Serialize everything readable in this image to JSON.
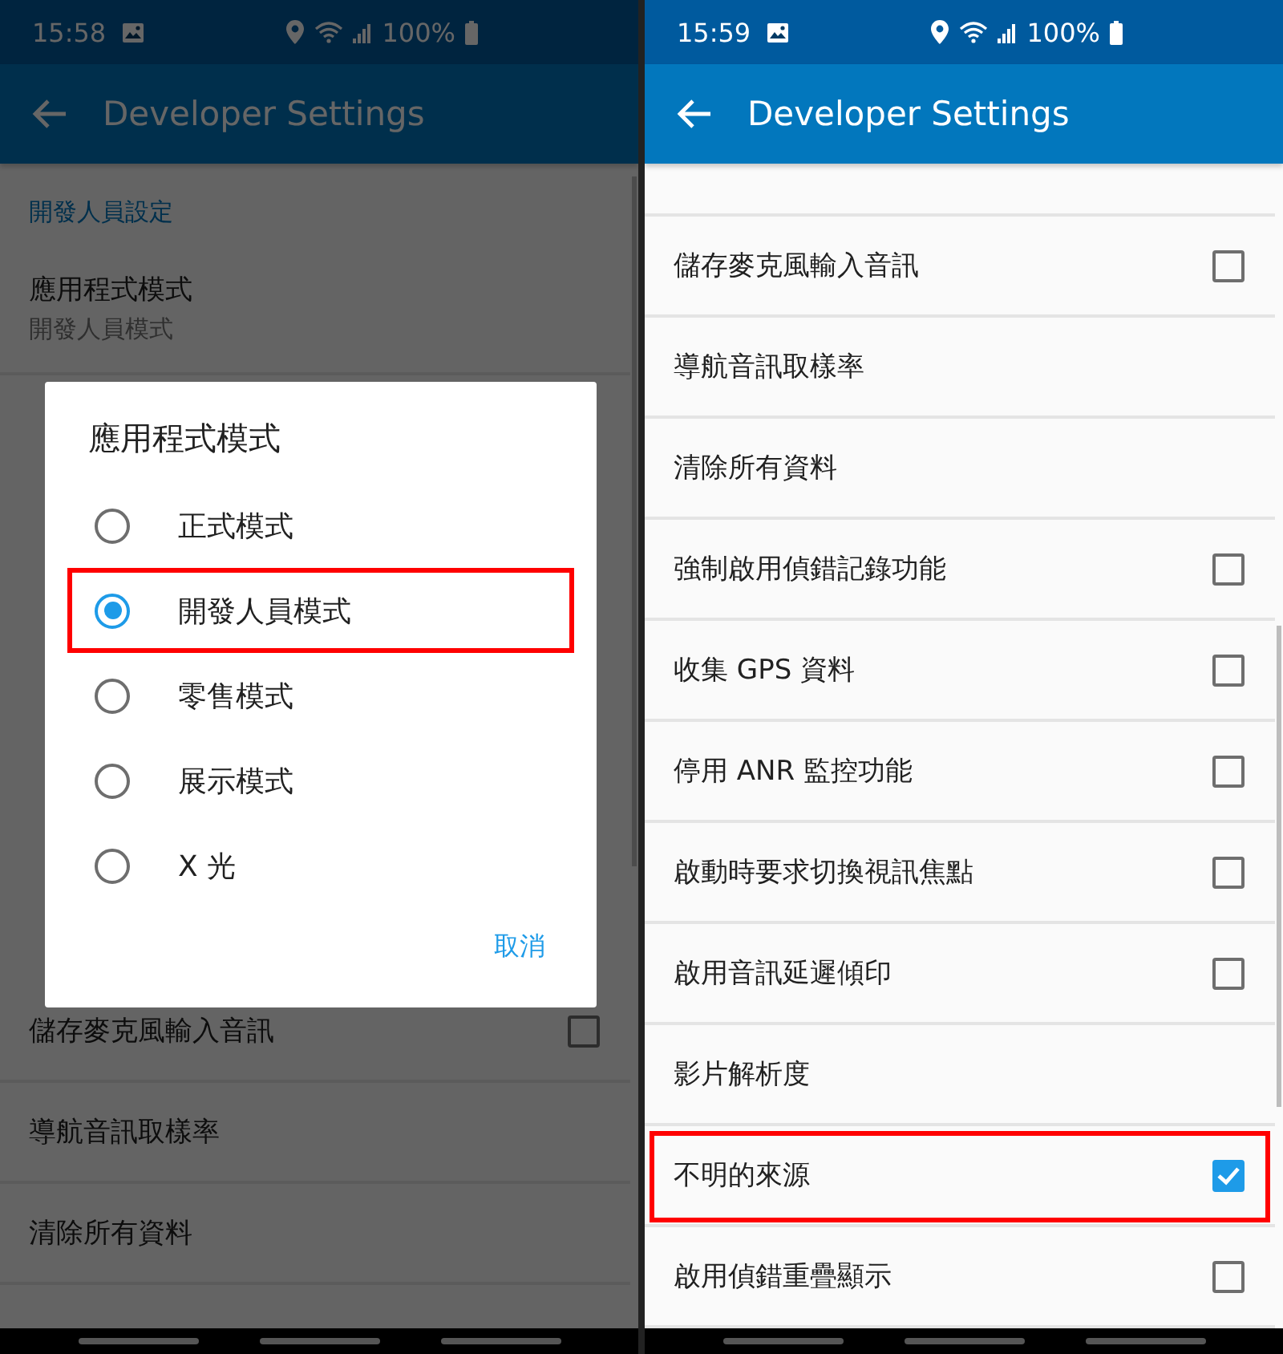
{
  "screens": [
    {
      "time": "15:58",
      "battery": "100%",
      "title": "Developer Settings",
      "dimmed": true,
      "section": "開發人員設定",
      "scroll_offset": false,
      "rows": [
        {
          "kind": "summary",
          "label": "應用程式模式",
          "summary": "開發人員模式",
          "highlighted": false
        },
        {
          "kind": "checkbox",
          "label": "儲存麥克風輸入音訊",
          "checked": false,
          "highlighted": false
        },
        {
          "kind": "plain",
          "label": "導航音訊取樣率",
          "highlighted": false
        },
        {
          "kind": "plain",
          "label": "清除所有資料",
          "highlighted": false
        }
      ],
      "dialog": {
        "title": "應用程式模式",
        "options": [
          {
            "label": "正式模式",
            "selected": false,
            "highlighted": false
          },
          {
            "label": "開發人員模式",
            "selected": true,
            "highlighted": true
          },
          {
            "label": "零售模式",
            "selected": false,
            "highlighted": false
          },
          {
            "label": "展示模式",
            "selected": false,
            "highlighted": false
          },
          {
            "label": "X 光",
            "selected": false,
            "highlighted": false
          }
        ],
        "cancel": "取消"
      }
    },
    {
      "time": "15:59",
      "battery": "100%",
      "title": "Developer Settings",
      "dimmed": false,
      "scroll_offset": true,
      "rows": [
        {
          "kind": "checkbox",
          "label": "儲存麥克風輸入音訊",
          "checked": false,
          "highlighted": false
        },
        {
          "kind": "plain",
          "label": "導航音訊取樣率",
          "highlighted": false
        },
        {
          "kind": "plain",
          "label": "清除所有資料",
          "highlighted": false
        },
        {
          "kind": "checkbox",
          "label": "強制啟用偵錯記錄功能",
          "checked": false,
          "highlighted": false
        },
        {
          "kind": "checkbox",
          "label": "收集 GPS 資料",
          "checked": false,
          "highlighted": false
        },
        {
          "kind": "checkbox",
          "label": "停用 ANR 監控功能",
          "checked": false,
          "highlighted": false
        },
        {
          "kind": "checkbox",
          "label": "啟動時要求切換視訊焦點",
          "checked": false,
          "highlighted": false
        },
        {
          "kind": "checkbox",
          "label": "啟用音訊延遲傾印",
          "checked": false,
          "highlighted": false
        },
        {
          "kind": "plain",
          "label": "影片解析度",
          "highlighted": false
        },
        {
          "kind": "checkbox",
          "label": "不明的來源",
          "checked": true,
          "highlighted": true
        },
        {
          "kind": "checkbox",
          "label": "啟用偵錯重疊顯示",
          "checked": false,
          "highlighted": false
        }
      ]
    }
  ]
}
